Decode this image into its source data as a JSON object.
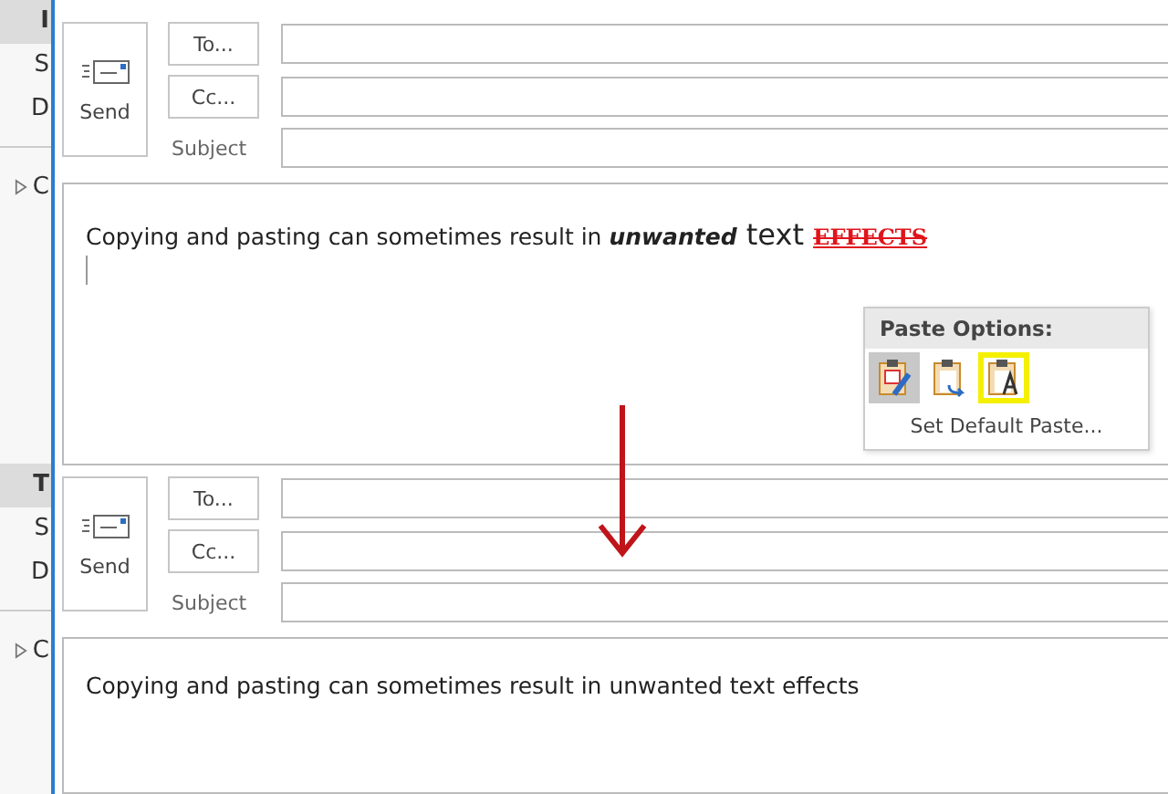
{
  "sidebar": {
    "groups": [
      {
        "items": [
          {
            "label": "I",
            "selected": true
          },
          {
            "label": "S",
            "selected": false
          },
          {
            "label": "D",
            "selected": false
          }
        ],
        "folder": {
          "label": "C",
          "expanded": false
        }
      },
      {
        "items": [
          {
            "label": "T",
            "selected": true
          },
          {
            "label": "S",
            "selected": false
          },
          {
            "label": "D",
            "selected": false
          }
        ],
        "folder": {
          "label": "C",
          "expanded": false
        }
      }
    ]
  },
  "composers": [
    {
      "send": "Send",
      "to": "To...",
      "cc": "Cc...",
      "subject": "Subject",
      "body": [
        {
          "kind": "plain",
          "text": "Copying and pasting can sometimes result in "
        },
        {
          "kind": "bold-italic",
          "text": "unwanted"
        },
        {
          "kind": "large",
          "text": " text "
        },
        {
          "kind": "effects",
          "text": "EFFECTS"
        }
      ],
      "cursor": true,
      "paste_options": {
        "title": "Paste Options:",
        "options": [
          {
            "selected": true,
            "highlighted": false
          },
          {
            "selected": false,
            "highlighted": false
          },
          {
            "selected": false,
            "highlighted": true
          }
        ],
        "default": "Set Default Paste..."
      }
    },
    {
      "send": "Send",
      "to": "To...",
      "cc": "Cc...",
      "subject": "Subject",
      "body": [
        {
          "kind": "plain",
          "text": "Copying and pasting can sometimes result in unwanted text effects"
        }
      ]
    }
  ]
}
